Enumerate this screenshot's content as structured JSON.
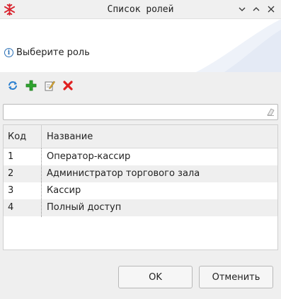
{
  "window": {
    "title": "Список ролей",
    "controls": [
      "chevron-down-icon",
      "chevron-up-icon",
      "close-icon"
    ]
  },
  "header": {
    "hint": "Выберите роль",
    "icon": "info-icon"
  },
  "toolbar": {
    "buttons": [
      "refresh-icon",
      "add-icon",
      "edit-icon",
      "delete-icon"
    ]
  },
  "search": {
    "value": "",
    "placeholder": ""
  },
  "table": {
    "columns": [
      "Код",
      "Название"
    ],
    "rows": [
      [
        "1",
        "Оператор-кассир"
      ],
      [
        "2",
        "Администратор торгового зала"
      ],
      [
        "3",
        "Кассир"
      ],
      [
        "4",
        "Полный доступ"
      ]
    ]
  },
  "footer": {
    "ok_label": "OK",
    "cancel_label": "Отменить"
  },
  "colors": {
    "accent": "#d9232e",
    "info": "#2a6fb5",
    "add": "#2fa52f",
    "delete": "#e02020"
  }
}
